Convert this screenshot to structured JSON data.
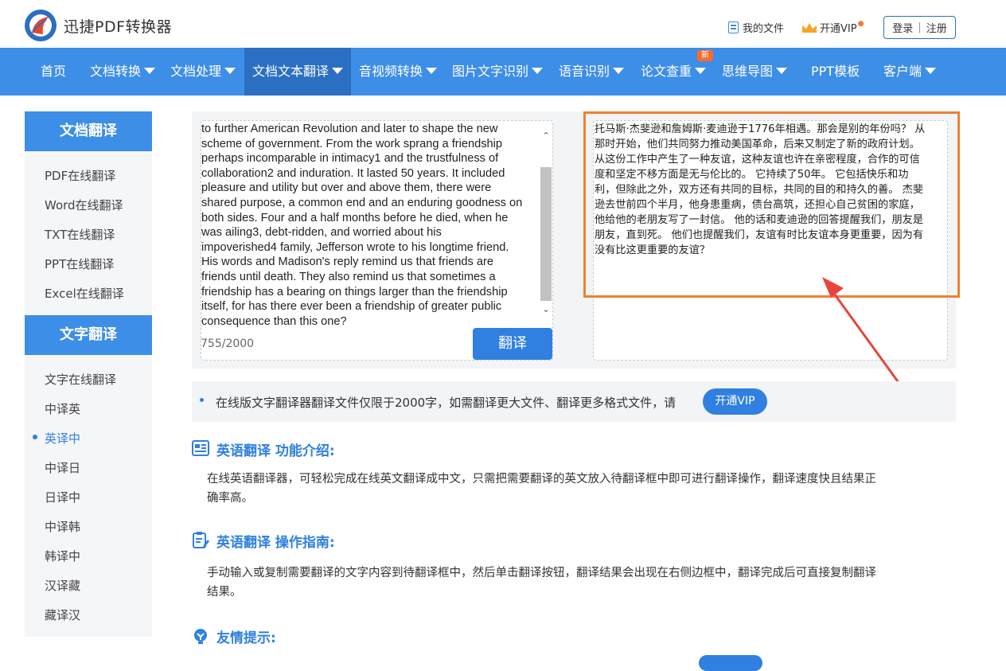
{
  "header": {
    "brand": "迅捷PDF转换器",
    "my_files": "我的文件",
    "open_vip": "开通VIP",
    "login": "登录",
    "register": "注册"
  },
  "nav": {
    "items": [
      {
        "label": "首页"
      },
      {
        "label": "文档转换"
      },
      {
        "label": "文档处理"
      },
      {
        "label": "文档文本翻译"
      },
      {
        "label": "音视频转换"
      },
      {
        "label": "图片文字识别"
      },
      {
        "label": "语音识别"
      },
      {
        "label": "论文查重"
      },
      {
        "label": "思维导图"
      },
      {
        "label": "PPT模板"
      },
      {
        "label": "客户端"
      }
    ],
    "new_badge": "新",
    "active_index": 3
  },
  "sidebar": {
    "doc_title": "文档翻译",
    "doc_items": [
      "PDF在线翻译",
      "Word在线翻译",
      "TXT在线翻译",
      "PPT在线翻译",
      "Excel在线翻译"
    ],
    "text_title": "文字翻译",
    "text_items": [
      "文字在线翻译",
      "中译英",
      "英译中",
      "中译日",
      "日译中",
      "中译韩",
      "韩译中",
      "汉译藏",
      "藏译汉"
    ],
    "active_item": "英译中"
  },
  "translator": {
    "source_lines": [
      "to further American Revolution and later to shape the new",
      "scheme of government. From the work sprang a friendship",
      "perhaps incomparable in intimacy1 and the trustfulness of",
      "collaboration2 and induration. It lasted 50 years. It included",
      "pleasure and utility but over and above them, there were",
      "shared purpose, a common end and an enduring goodness on",
      "both sides. Four and a half months before he died, when he",
      "was ailing3, debt-ridden, and worried about his",
      "impoverished4 family, Jefferson wrote to his longtime friend.",
      "His words and Madison's reply remind us that friends are",
      "friends until death. They also remind us that sometimes a",
      "friendship has a bearing on things larger than the friendship",
      "itself, for has there ever been a friendship of greater public",
      "consequence than this one?"
    ],
    "char_count": "755/2000",
    "translate_button": "翻译",
    "result_lines": [
      "托马斯·杰斐逊和詹姆斯·麦迪逊于1776年相遇。那会是别的年份吗？ 从",
      "那时开始，他们共同努力推动美国革命，后来又制定了新的政府计划。",
      "从这份工作中产生了一种友谊，这种友谊也许在亲密程度，合作的可信",
      "度和坚定不移方面是无与伦比的。 它持续了50年。 它包括快乐和功",
      "利，但除此之外，双方还有共同的目标，共同的目的和持久的善。 杰斐",
      "逊去世前四个半月，他身患重病，债台高筑，还担心自己贫困的家庭，",
      "他给他的老朋友写了一封信。 他的话和麦迪逊的回答提醒我们，朋友是",
      "朋友，直到死。 他们也提醒我们，友谊有时比友谊本身更重要，因为有",
      "没有比这更重要的友谊？"
    ],
    "highlight_color": "#f07f30"
  },
  "notice": {
    "text": "在线版文字翻译器翻译文件仅限于2000字，如需翻译更大文件、翻译更多格式文件，请",
    "vip_button": "开通VIP"
  },
  "sections": [
    {
      "icon": "newspaper-icon",
      "title": "英语翻译 功能介绍:",
      "lines": [
        "在线英语翻译器，可轻松完成在线英文翻译成中文，只需把需要翻译的英文放入待翻译框中即可进行翻译操作，翻译速度快且结果正",
        "确率高。"
      ]
    },
    {
      "icon": "clipboard-edit-icon",
      "title": "英语翻译 操作指南:",
      "lines": [
        "手动输入或复制需要翻译的文字内容到待翻译框中，然后单击翻译按钮，翻译结果会出现在右侧边框中，翻译完成后可直接复制翻译",
        "结果。"
      ]
    },
    {
      "icon": "lightbulb-icon",
      "title": "友情提示:",
      "lines": []
    }
  ],
  "colors": {
    "brand_blue": "#3d8ee6",
    "active_nav": "#2a6fc2",
    "button_blue": "#2f80e0",
    "badge_orange": "#f56c2c"
  }
}
